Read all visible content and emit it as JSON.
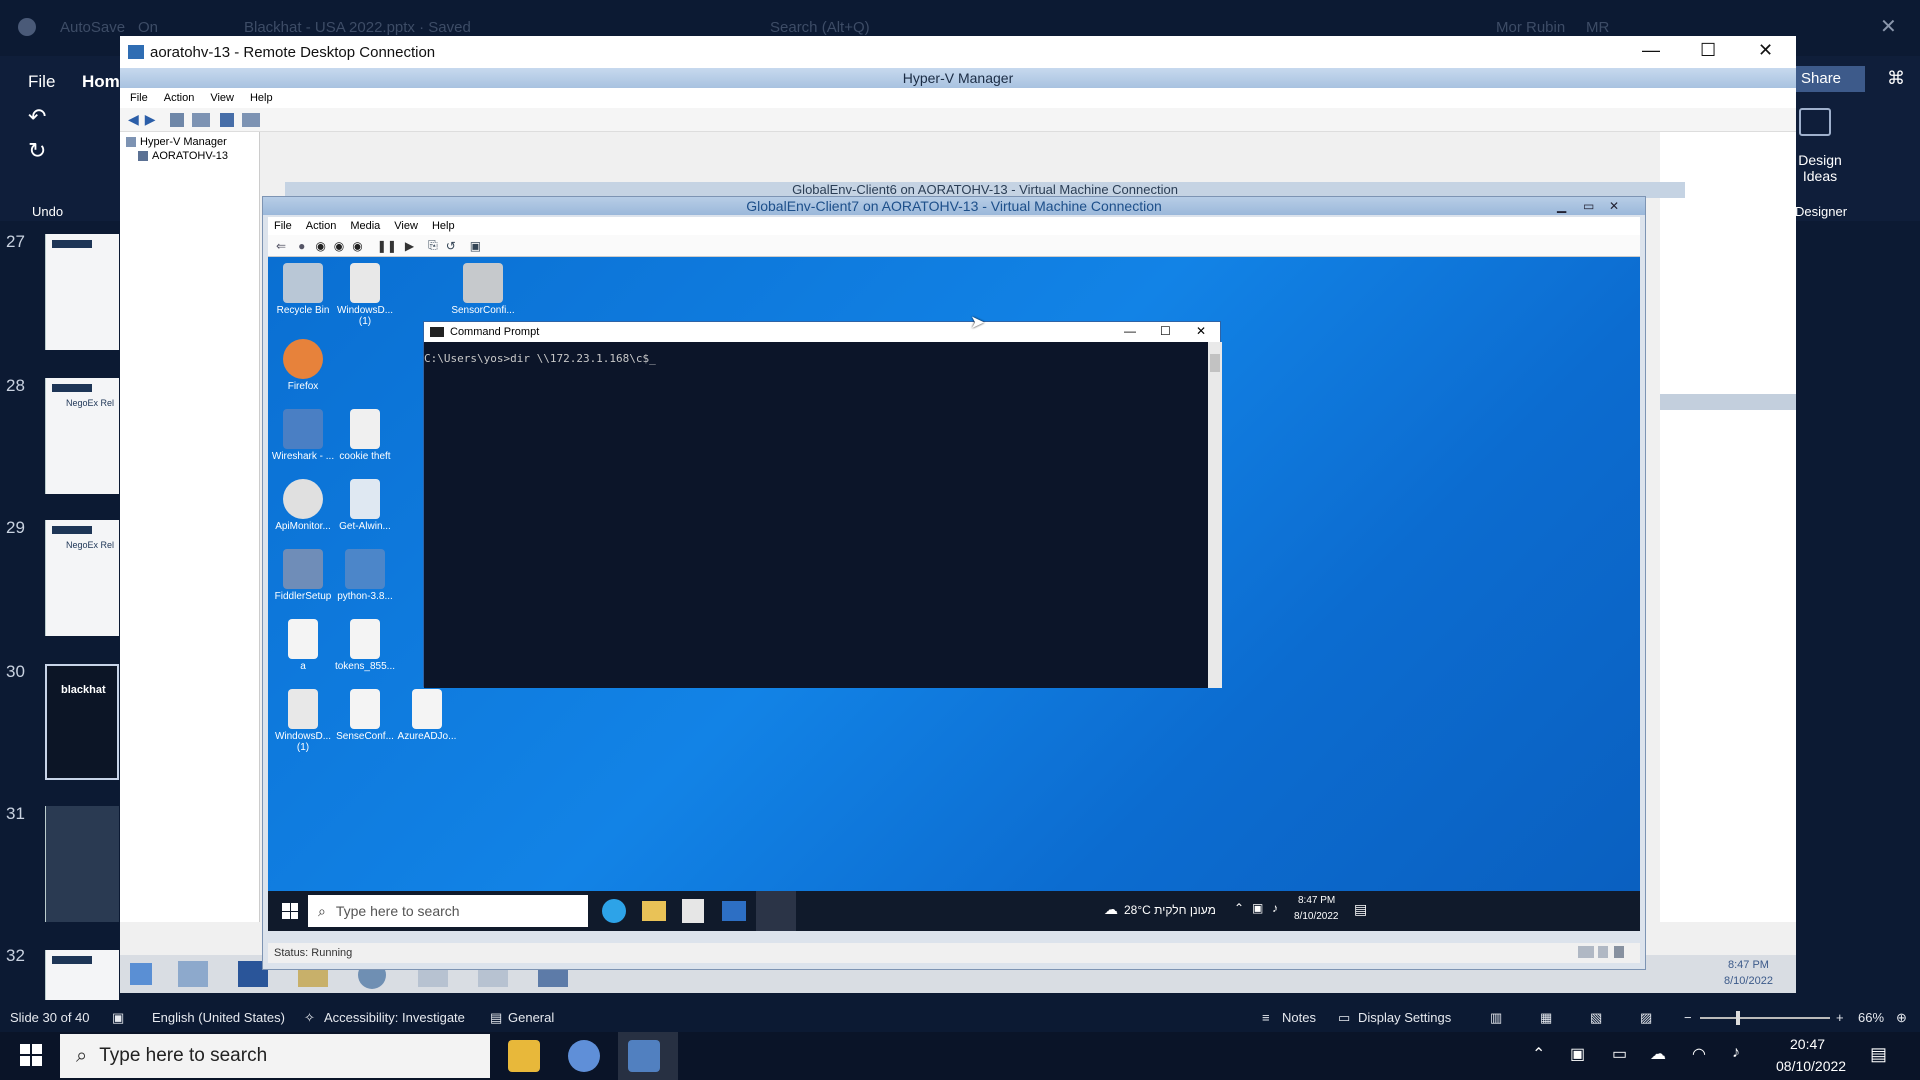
{
  "ppt": {
    "faint_title": "AutoSave",
    "faint_on": "On",
    "faint_doc": "Blackhat - USA 2022.pptx · Saved",
    "faint_search": "Search (Alt+Q)",
    "faint_user": "Mor Rubin",
    "faint_initials": "MR",
    "tabs": [
      "File",
      "Hom"
    ],
    "undo_label": "Undo",
    "share_label": "Share",
    "design_label": "Design Ideas",
    "designer_label": "Designer",
    "slide_numbers": [
      "27",
      "28",
      "29",
      "30",
      "31",
      "32"
    ],
    "slide_thumb_texts": [
      "NegoEx Rel",
      "NegoEx Rel",
      "blackhat"
    ],
    "status": {
      "slide": "Slide 30 of 40",
      "language": "English (United States)",
      "accessibility": "Accessibility: Investigate",
      "sensitivity": "General",
      "notes": "Notes",
      "display": "Display Settings",
      "zoom": "66%"
    }
  },
  "host_taskbar": {
    "search_placeholder": "Type here to search",
    "time": "20:47",
    "date": "08/10/2022"
  },
  "rdp": {
    "title": "aoratohv-13 - Remote Desktop Connection"
  },
  "hyperv": {
    "title": "Hyper-V Manager",
    "menu": [
      "File",
      "Action",
      "View",
      "Help"
    ],
    "tree_root": "Hyper-V Manager",
    "tree_child": "AORATOHV-13",
    "tray_time": "8:47 PM",
    "tray_date": "8/10/2022"
  },
  "vm_back": {
    "title": "GlobalEnv-Client6 on AORATOHV-13 - Virtual Machine Connection"
  },
  "vm": {
    "title": "GlobalEnv-Client7 on AORATOHV-13 - Virtual Machine Connection",
    "menu": [
      "File",
      "Action",
      "Media",
      "View",
      "Help"
    ],
    "status": "Status: Running",
    "desktop_icons": [
      "Recycle Bin",
      "WindowsD... (1)",
      "SensorConfi...",
      "Firefox",
      "Wireshark - ...",
      "cookie theft",
      "ApiMonitor...",
      "Get-Alwin...",
      "FiddlerSetup",
      "python-3.8...",
      "a",
      "tokens_855...",
      "WindowsD... (1)",
      "SenseConf...",
      "AzureADJo..."
    ],
    "taskbar_search": "Type here to search",
    "weather": "28°C  מעונן חלקית",
    "time": "8:47 PM",
    "date": "8/10/2022"
  },
  "cmd": {
    "title": "Command Prompt",
    "line": "C:\\Users\\yos>dir \\\\172.23.1.168\\c$"
  }
}
